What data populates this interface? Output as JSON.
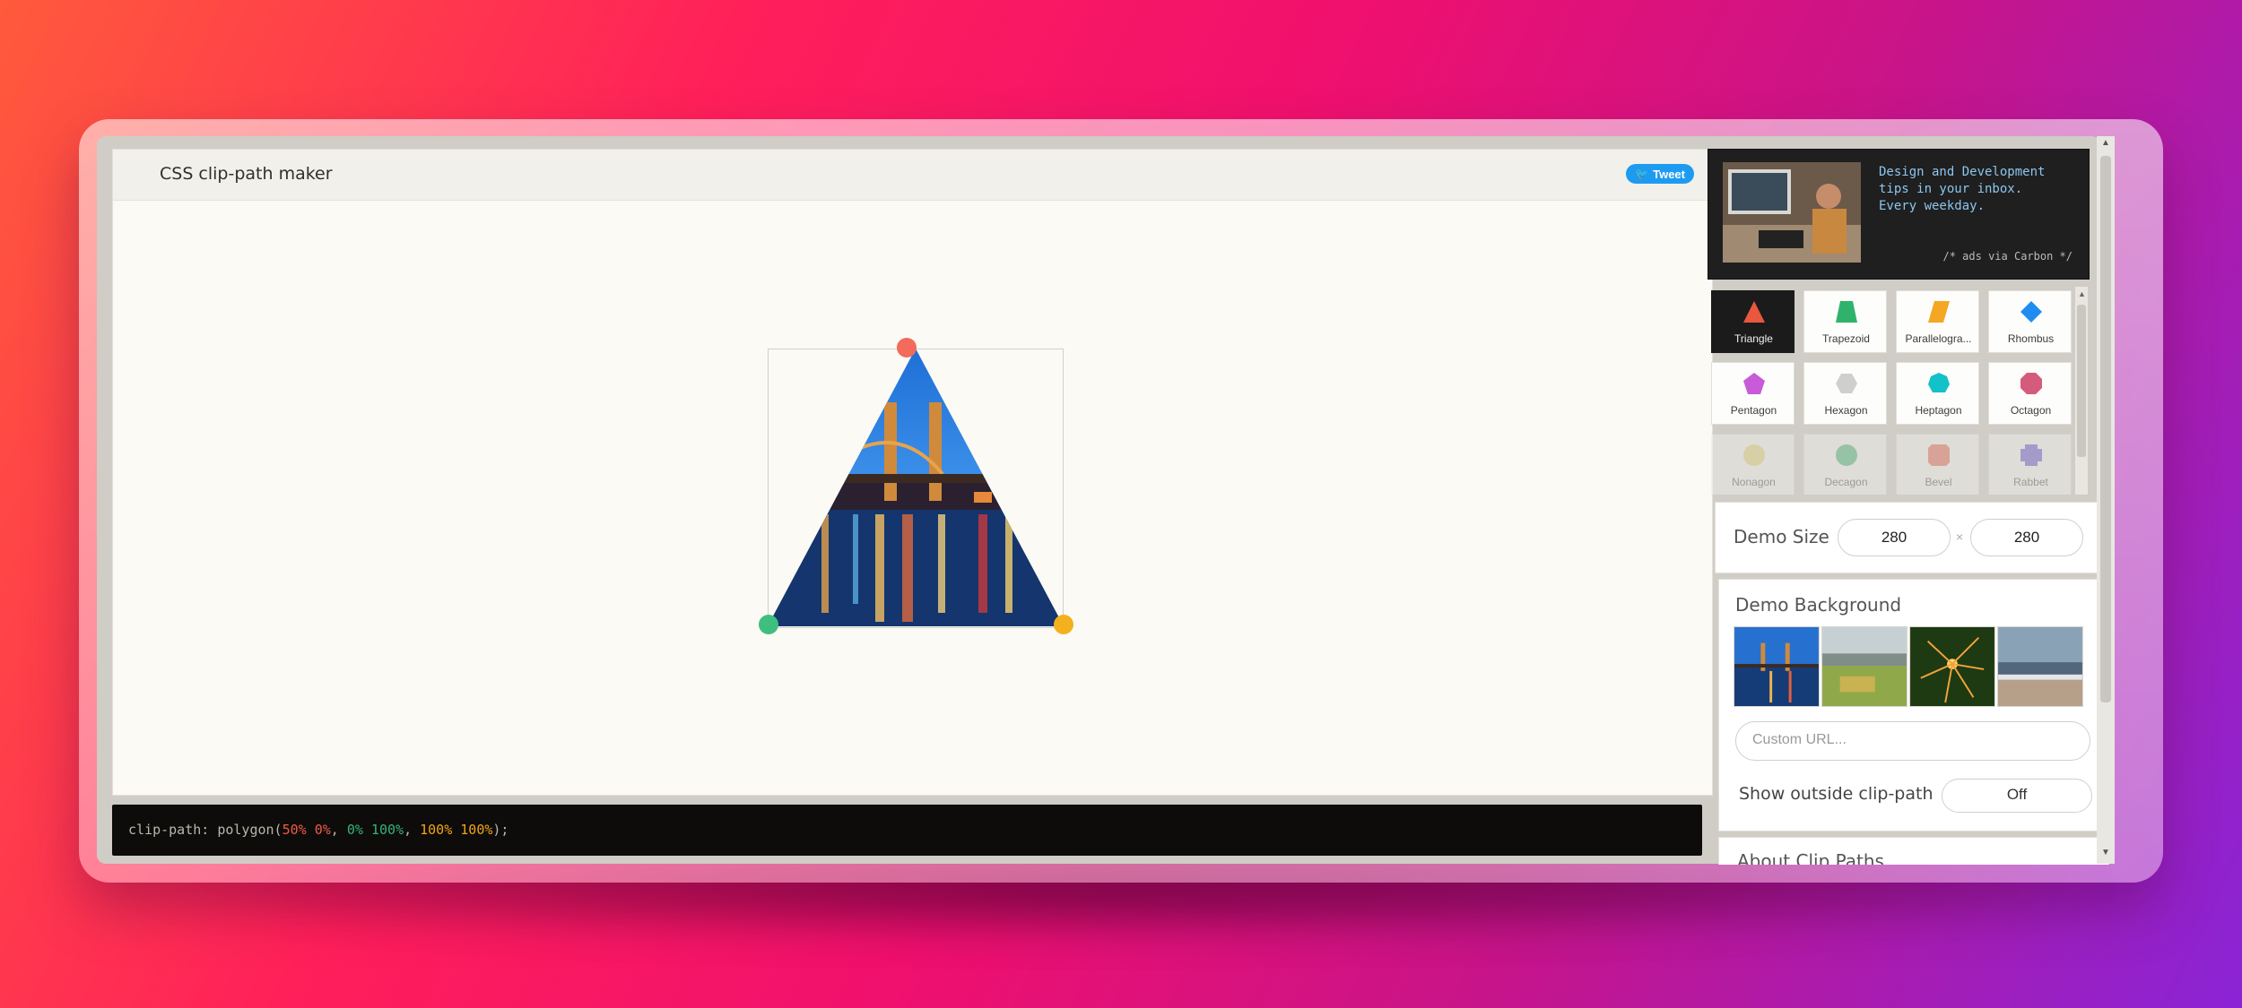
{
  "app": {
    "title": "CSS clip-path maker",
    "tweet_label": "Tweet"
  },
  "code": {
    "property": "clip-path:",
    "func_open": "polygon(",
    "points": [
      {
        "text": "50% 0%",
        "color": "#f05a48"
      },
      {
        "text": "0% 100%",
        "color": "#34b37a"
      },
      {
        "text": "100% 100%",
        "color": "#f0a51a"
      }
    ],
    "separator": ", ",
    "func_close": ");",
    "text_color": "#b9b6ad"
  },
  "handles": [
    {
      "name": "top",
      "color": "#f26b5b"
    },
    {
      "name": "bottom-left",
      "color": "#3fbf7f"
    },
    {
      "name": "bottom-right",
      "color": "#f3b01f"
    }
  ],
  "ad": {
    "text": "Design and Development\ntips in your inbox.\nEvery weekday.",
    "via": "/* ads via Carbon */"
  },
  "shapes": [
    {
      "label": "Triangle",
      "icon": "triangle-icon",
      "color": "#e9573f",
      "active": true
    },
    {
      "label": "Trapezoid",
      "icon": "trapezoid-icon",
      "color": "#2fb36c",
      "active": false
    },
    {
      "label": "Parallelogra...",
      "icon": "parallelogram-icon",
      "color": "#f5a623",
      "active": false
    },
    {
      "label": "Rhombus",
      "icon": "rhombus-icon",
      "color": "#1f8df0",
      "active": false
    },
    {
      "label": "Pentagon",
      "icon": "pentagon-icon",
      "color": "#c75bd8",
      "active": false
    },
    {
      "label": "Hexagon",
      "icon": "hexagon-icon",
      "color": "#cfcfcf",
      "active": false
    },
    {
      "label": "Heptagon",
      "icon": "heptagon-icon",
      "color": "#13c1c9",
      "active": false
    },
    {
      "label": "Octagon",
      "icon": "octagon-icon",
      "color": "#d55b7c",
      "active": false
    },
    {
      "label": "Nonagon",
      "icon": "nonagon-icon",
      "color": "#e6d36a",
      "active": false
    },
    {
      "label": "Decagon",
      "icon": "decagon-icon",
      "color": "#2fb36c",
      "active": false
    },
    {
      "label": "Bevel",
      "icon": "bevel-icon",
      "color": "#e9573f",
      "active": false
    },
    {
      "label": "Rabbet",
      "icon": "rabbet-icon",
      "color": "#5a3fd4",
      "active": false
    }
  ],
  "demo_size": {
    "label": "Demo Size",
    "width": "280",
    "height": "280",
    "times": "×"
  },
  "demo_background": {
    "label": "Demo Background",
    "custom_url_placeholder": "Custom URL...",
    "outside_label": "Show outside clip-path",
    "outside_value": "Off"
  },
  "about": {
    "title": "About Clip Paths"
  }
}
